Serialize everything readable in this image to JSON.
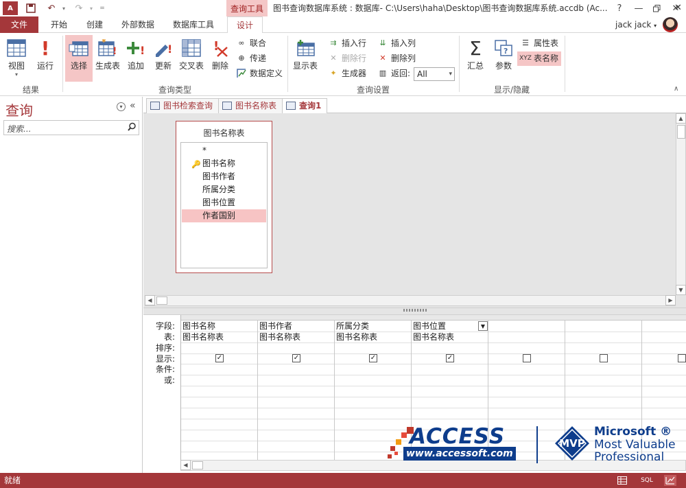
{
  "titlebar": {
    "context_tab": "查询工具",
    "title": "图书查询数据库系统 : 数据库- C:\\Users\\haha\\Desktop\\图书查询数据库系统.accdb (Ac...",
    "help": "?",
    "user": "jack jack"
  },
  "ribbon_tabs": [
    "文件",
    "开始",
    "创建",
    "外部数据",
    "数据库工具",
    "设计"
  ],
  "ribbon": {
    "results": {
      "label": "结果",
      "view": "视图",
      "run": "运行"
    },
    "query_type": {
      "label": "查询类型",
      "select": "选择",
      "make_table": "生成表",
      "append": "追加",
      "update": "更新",
      "crosstab": "交叉表",
      "delete": "删除",
      "union": "联合",
      "passthrough": "传递",
      "data_definition": "数据定义"
    },
    "query_setup": {
      "label": "查询设置",
      "show_table": "显示表",
      "insert_rows": "插入行",
      "delete_rows": "删除行",
      "builder": "生成器",
      "insert_cols": "插入列",
      "delete_cols": "删除列",
      "return_label": "返回:",
      "return_value": "All"
    },
    "show_hide": {
      "label": "显示/隐藏",
      "totals": "汇总",
      "parameters": "参数",
      "property_sheet": "属性表",
      "table_names": "表名称"
    }
  },
  "nav": {
    "title": "查询",
    "search_placeholder": "搜索..."
  },
  "doc_tabs": [
    "图书检索查询",
    "图书名称表",
    "查询1"
  ],
  "table_box": {
    "title": "图书名称表",
    "fields": [
      "*",
      "图书名称",
      "图书作者",
      "所属分类",
      "图书位置",
      "作者国别"
    ]
  },
  "grid": {
    "row_labels": [
      "字段:",
      "表:",
      "排序:",
      "显示:",
      "条件:",
      "或:"
    ],
    "columns": [
      {
        "field": "图书名称",
        "table": "图书名称表",
        "show": true
      },
      {
        "field": "图书作者",
        "table": "图书名称表",
        "show": true
      },
      {
        "field": "所属分类",
        "table": "图书名称表",
        "show": true
      },
      {
        "field": "图书位置",
        "table": "图书名称表",
        "show": true
      },
      {
        "field": "",
        "table": "",
        "show": false
      },
      {
        "field": "",
        "table": "",
        "show": false
      },
      {
        "field": "",
        "table": "",
        "show": false
      }
    ]
  },
  "logo": {
    "access": "ACCESS",
    "url": "www.accessoft.com",
    "mvp": "MVP",
    "microsoft": "Microsoft ®",
    "line1": "Most Valuable",
    "line2": "Professional"
  },
  "status": {
    "text": "就绪",
    "sql": "SQL"
  },
  "colors": {
    "accent": "#a4373a",
    "context": "#f4c7c7",
    "logo_blue": "#0e3d8c"
  }
}
